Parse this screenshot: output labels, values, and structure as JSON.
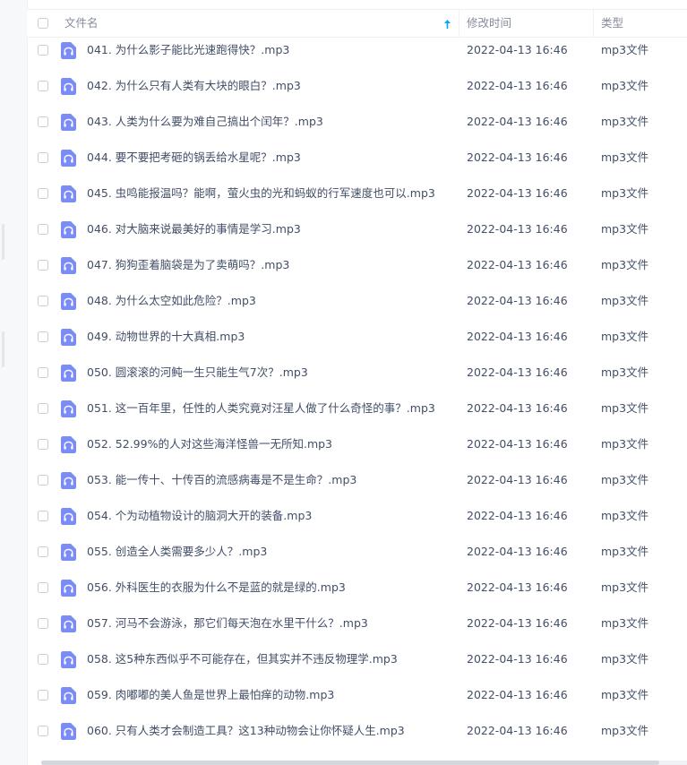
{
  "header": {
    "name_label": "文件名",
    "modified_label": "修改时间",
    "type_label": "类型"
  },
  "colors": {
    "accent": "#06a7ff",
    "file_icon": "#7b8cf8"
  },
  "files": [
    {
      "name": "041. 为什么影子能比光速跑得快？.mp3",
      "modified": "2022-04-13 16:46",
      "type": "mp3文件",
      "icon": "audio-file-icon"
    },
    {
      "name": "042. 为什么只有人类有大块的眼白？.mp3",
      "modified": "2022-04-13 16:46",
      "type": "mp3文件",
      "icon": "audio-file-icon"
    },
    {
      "name": "043. 人类为什么要为难自己搞出个闰年？.mp3",
      "modified": "2022-04-13 16:46",
      "type": "mp3文件",
      "icon": "audio-file-icon"
    },
    {
      "name": "044. 要不要把考砸的锅丢给水星呢？.mp3",
      "modified": "2022-04-13 16:46",
      "type": "mp3文件",
      "icon": "audio-file-icon"
    },
    {
      "name": "045. 虫鸣能报温吗？能啊，萤火虫的光和蚂蚁的行军速度也可以.mp3",
      "modified": "2022-04-13 16:46",
      "type": "mp3文件",
      "icon": "audio-file-icon"
    },
    {
      "name": "046. 对大脑来说最美好的事情是学习.mp3",
      "modified": "2022-04-13 16:46",
      "type": "mp3文件",
      "icon": "audio-file-icon"
    },
    {
      "name": "047. 狗狗歪着脑袋是为了卖萌吗？.mp3",
      "modified": "2022-04-13 16:46",
      "type": "mp3文件",
      "icon": "audio-file-icon"
    },
    {
      "name": "048. 为什么太空如此危险？.mp3",
      "modified": "2022-04-13 16:46",
      "type": "mp3文件",
      "icon": "audio-file-icon"
    },
    {
      "name": "049. 动物世界的十大真相.mp3",
      "modified": "2022-04-13 16:46",
      "type": "mp3文件",
      "icon": "audio-file-icon"
    },
    {
      "name": "050. 圆滚滚的河鲀一生只能生气7次？.mp3",
      "modified": "2022-04-13 16:46",
      "type": "mp3文件",
      "icon": "audio-file-icon"
    },
    {
      "name": "051. 这一百年里，任性的人类究竟对汪星人做了什么奇怪的事？.mp3",
      "modified": "2022-04-13 16:46",
      "type": "mp3文件",
      "icon": "audio-file-icon"
    },
    {
      "name": "052. 52.99%的人对这些海洋怪兽一无所知.mp3",
      "modified": "2022-04-13 16:46",
      "type": "mp3文件",
      "icon": "audio-file-icon"
    },
    {
      "name": "053. 能一传十、十传百的流感病毒是不是生命？.mp3",
      "modified": "2022-04-13 16:46",
      "type": "mp3文件",
      "icon": "audio-file-icon"
    },
    {
      "name": "054. 个为动植物设计的脑洞大开的装备.mp3",
      "modified": "2022-04-13 16:46",
      "type": "mp3文件",
      "icon": "audio-file-icon"
    },
    {
      "name": "055. 创造全人类需要多少人？.mp3",
      "modified": "2022-04-13 16:46",
      "type": "mp3文件",
      "icon": "audio-file-icon"
    },
    {
      "name": "056. 外科医生的衣服为什么不是蓝的就是绿的.mp3",
      "modified": "2022-04-13 16:46",
      "type": "mp3文件",
      "icon": "audio-file-icon"
    },
    {
      "name": "057. 河马不会游泳，那它们每天泡在水里干什么？.mp3",
      "modified": "2022-04-13 16:46",
      "type": "mp3文件",
      "icon": "audio-file-icon"
    },
    {
      "name": "058. 这5种东西似乎不可能存在，但其实并不违反物理学.mp3",
      "modified": "2022-04-13 16:46",
      "type": "mp3文件",
      "icon": "audio-file-icon"
    },
    {
      "name": "059. 肉嘟嘟的美人鱼是世界上最怕痒的动物.mp3",
      "modified": "2022-04-13 16:46",
      "type": "mp3文件",
      "icon": "audio-file-icon"
    },
    {
      "name": "060. 只有人类才会制造工具？这13种动物会让你怀疑人生.mp3",
      "modified": "2022-04-13 16:46",
      "type": "mp3文件",
      "icon": "audio-file-icon"
    }
  ]
}
